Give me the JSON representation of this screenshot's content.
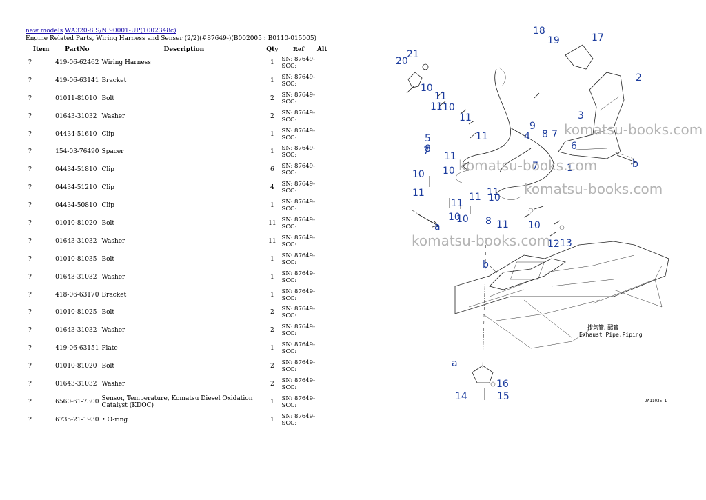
{
  "breadcrumb": {
    "link1": "new models",
    "link2": "WA320-8 S/N 90001-UP(1002348c)"
  },
  "page_title": "Engine Related Parts, Wiring Harness and Senser (2/2)(#87649-)(B002005 : B0110-015005)",
  "table": {
    "headers": {
      "item": "Item",
      "partno": "PartNo",
      "description": "Description",
      "qty": "Qty",
      "ref": "Ref",
      "alt": "Alt"
    },
    "rows": [
      {
        "item": "?",
        "partno": "419-06-62462",
        "description": "Wiring Harness",
        "qty": "1",
        "ref": "SN: 87649-SCC:"
      },
      {
        "item": "?",
        "partno": "419-06-63141",
        "description": "Bracket",
        "qty": "1",
        "ref": "SN: 87649-SCC:"
      },
      {
        "item": "?",
        "partno": "01011-81010",
        "description": "Bolt",
        "qty": "2",
        "ref": "SN: 87649-SCC:"
      },
      {
        "item": "?",
        "partno": "01643-31032",
        "description": "Washer",
        "qty": "2",
        "ref": "SN: 87649-SCC:"
      },
      {
        "item": "?",
        "partno": "04434-51610",
        "description": "Clip",
        "qty": "1",
        "ref": "SN: 87649-SCC:"
      },
      {
        "item": "?",
        "partno": "154-03-76490",
        "description": "Spacer",
        "qty": "1",
        "ref": "SN: 87649-SCC:"
      },
      {
        "item": "?",
        "partno": "04434-51810",
        "description": "Clip",
        "qty": "6",
        "ref": "SN: 87649-SCC:"
      },
      {
        "item": "?",
        "partno": "04434-51210",
        "description": "Clip",
        "qty": "4",
        "ref": "SN: 87649-SCC:"
      },
      {
        "item": "?",
        "partno": "04434-50810",
        "description": "Clip",
        "qty": "1",
        "ref": "SN: 87649-SCC:"
      },
      {
        "item": "?",
        "partno": "01010-81020",
        "description": "Bolt",
        "qty": "11",
        "ref": "SN: 87649-SCC:"
      },
      {
        "item": "?",
        "partno": "01643-31032",
        "description": "Washer",
        "qty": "11",
        "ref": "SN: 87649-SCC:"
      },
      {
        "item": "?",
        "partno": "01010-81035",
        "description": "Bolt",
        "qty": "1",
        "ref": "SN: 87649-SCC:"
      },
      {
        "item": "?",
        "partno": "01643-31032",
        "description": "Washer",
        "qty": "1",
        "ref": "SN: 87649-SCC:"
      },
      {
        "item": "?",
        "partno": "418-06-63170",
        "description": "Bracket",
        "qty": "1",
        "ref": "SN: 87649-SCC:"
      },
      {
        "item": "?",
        "partno": "01010-81025",
        "description": "Bolt",
        "qty": "2",
        "ref": "SN: 87649-SCC:"
      },
      {
        "item": "?",
        "partno": "01643-31032",
        "description": "Washer",
        "qty": "2",
        "ref": "SN: 87649-SCC:"
      },
      {
        "item": "?",
        "partno": "419-06-63151",
        "description": "Plate",
        "qty": "1",
        "ref": "SN: 87649-SCC:"
      },
      {
        "item": "?",
        "partno": "01010-81020",
        "description": "Bolt",
        "qty": "2",
        "ref": "SN: 87649-SCC:"
      },
      {
        "item": "?",
        "partno": "01643-31032",
        "description": "Washer",
        "qty": "2",
        "ref": "SN: 87649-SCC:"
      },
      {
        "item": "?",
        "partno": "6560-61-7300",
        "description": "Sensor, Temperature, Komatsu Diesel Oxidation Catalyst (KDOC)",
        "qty": "1",
        "ref": "SN: 87649-SCC:"
      },
      {
        "item": "?",
        "partno": "6735-21-1930",
        "description": "• O-ring",
        "qty": "1",
        "ref": "SN: 87649-SCC:"
      }
    ]
  },
  "diagram": {
    "callouts": [
      "21",
      "20",
      "18",
      "19",
      "17",
      "2",
      "10",
      "11",
      "11",
      "10",
      "11",
      "11",
      "9",
      "3",
      "8",
      "5",
      "4",
      "8",
      "7",
      "7",
      "6",
      "11",
      "10",
      "7",
      "1",
      "10",
      "11",
      "11",
      "10",
      "11",
      "10",
      "11",
      "10",
      "8",
      "11",
      "10",
      "12",
      "13",
      "a",
      "b",
      "b",
      "a",
      "14",
      "16",
      "15"
    ],
    "watermark": "komatsu-books.com",
    "label_jp": "排気管, 配管",
    "label_en": "Exhaust Pipe,Piping",
    "figure_code": "JA11035 I"
  }
}
